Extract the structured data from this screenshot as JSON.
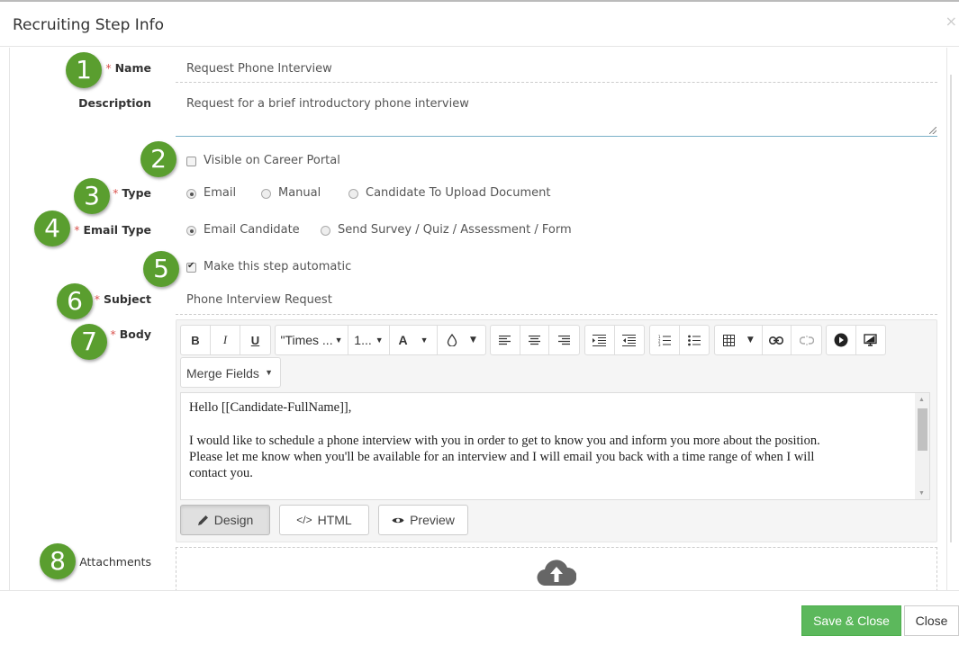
{
  "dialog": {
    "title": "Recruiting Step Info",
    "close_icon": "×"
  },
  "badges": [
    "1",
    "2",
    "3",
    "4",
    "5",
    "6",
    "7",
    "8"
  ],
  "form": {
    "name": {
      "label": "Name",
      "required": "*",
      "value": "Request Phone Interview"
    },
    "description": {
      "label": "Description",
      "value": "Request for a brief introductory phone interview"
    },
    "visible_on_portal": {
      "label": "Visible on Career Portal",
      "checked": false
    },
    "type": {
      "label": "Type",
      "required": "*",
      "options": [
        {
          "label": "Email",
          "selected": true
        },
        {
          "label": "Manual",
          "selected": false
        },
        {
          "label": "Candidate To Upload Document",
          "selected": false
        }
      ]
    },
    "email_type": {
      "label": "Email Type",
      "required": "*",
      "options": [
        {
          "label": "Email Candidate",
          "selected": true
        },
        {
          "label": "Send Survey / Quiz / Assessment / Form",
          "selected": false
        }
      ]
    },
    "automatic": {
      "label": "Make this step automatic",
      "checked": true
    },
    "subject": {
      "label": "Subject",
      "required": "*",
      "value": "Phone Interview Request"
    },
    "body": {
      "label": "Body",
      "required": "*",
      "toolbar": {
        "bold": "B",
        "italic": "I",
        "underline": "U",
        "font_family": "\"Times ...",
        "font_size": "1...",
        "font_color": "A",
        "caret": "▼",
        "merge_fields": "Merge Fields"
      },
      "content": {
        "greeting": "Hello [[Candidate-FullName]],",
        "line1": "I would like to schedule a phone interview with you in order to get to know you and inform you more about the position.",
        "line2": "Please let me know when you'll be available for an interview and I will email you back with a time range of when I will",
        "line3": "contact you."
      },
      "modes": [
        {
          "label": "Design",
          "icon": "pencil-icon",
          "active": true
        },
        {
          "label": "HTML",
          "icon": "code-icon",
          "active": false
        },
        {
          "label": "Preview",
          "icon": "eye-icon",
          "active": false
        }
      ]
    },
    "attachments": {
      "label": "Attachments",
      "icon": "cloud-upload-icon"
    }
  },
  "footer": {
    "save_close": "Save & Close",
    "close": "Close"
  },
  "colors": {
    "badge": "#5a9e2f",
    "save": "#5cb85c",
    "required": "#d9534f"
  }
}
